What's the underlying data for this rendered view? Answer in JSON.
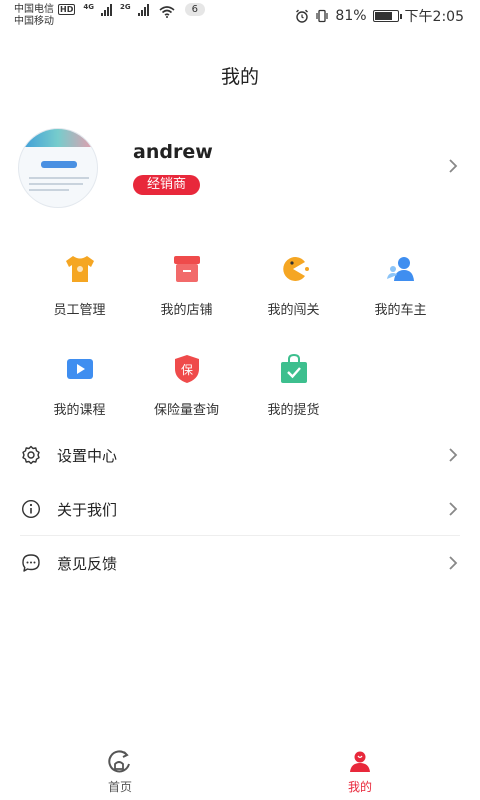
{
  "status_bar": {
    "carrier_1": "中国电信",
    "hd": "HD",
    "net_1": "4G",
    "net_2": "2G",
    "notif_count": "6",
    "carrier_2": "中国移动",
    "battery_percent": "81%",
    "battery_level": 0.81,
    "time": "下午2:05"
  },
  "page": {
    "title": "我的"
  },
  "profile": {
    "username": "andrew",
    "badge": "经销商"
  },
  "grid": [
    {
      "label": "员工管理",
      "icon": "tshirt-icon",
      "color": "#f5a623"
    },
    {
      "label": "我的店铺",
      "icon": "store-icon",
      "color": "#ef4b4b"
    },
    {
      "label": "我的闯关",
      "icon": "pacman-icon",
      "color": "#f5a623"
    },
    {
      "label": "我的车主",
      "icon": "users-icon",
      "color": "#3f8ef0"
    },
    {
      "label": "我的课程",
      "icon": "video-play-icon",
      "color": "#3f8ef0"
    },
    {
      "label": "保险量查询",
      "icon": "shield-icon",
      "shield_text": "保",
      "color": "#ef4b4b"
    },
    {
      "label": "我的提货",
      "icon": "bag-check-icon",
      "color": "#3dbf8e"
    }
  ],
  "menu": [
    {
      "label": "设置中心",
      "icon": "gear-icon"
    },
    {
      "label": "关于我们",
      "icon": "info-icon"
    },
    {
      "label": "意见反馈",
      "icon": "feedback-icon"
    }
  ],
  "tabbar": {
    "home": {
      "label": "首页",
      "color": "#555"
    },
    "mine": {
      "label": "我的",
      "color": "#e8283b"
    }
  }
}
